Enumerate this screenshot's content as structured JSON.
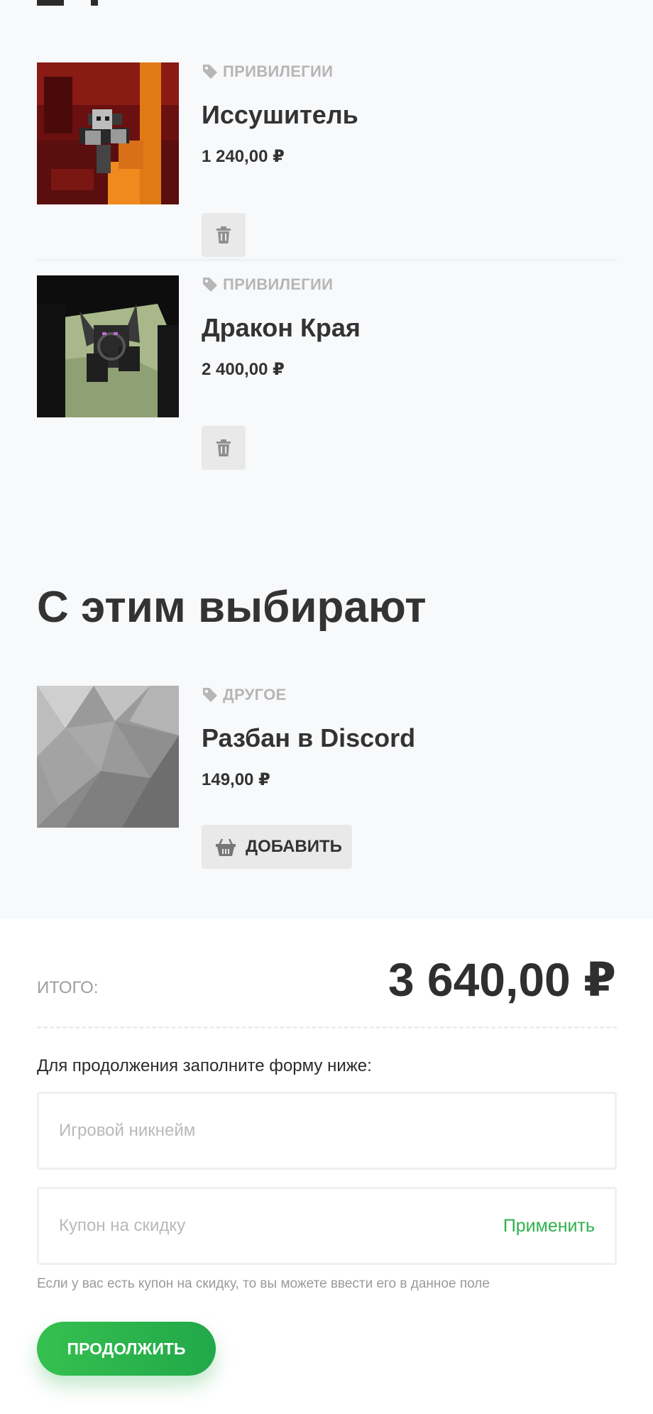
{
  "cart": {
    "items": [
      {
        "category": "ПРИВИЛЕГИИ",
        "name": "Иссушитель",
        "price": "1 240,00 ₽"
      },
      {
        "category": "ПРИВИЛЕГИИ",
        "name": "Дракон Края",
        "price": "2 400,00 ₽"
      }
    ]
  },
  "recommend": {
    "title": "С этим выбирают",
    "items": [
      {
        "category": "ДРУГОЕ",
        "name": "Разбан в Discord",
        "price": "149,00 ₽",
        "add_label": "ДОБАВИТЬ"
      }
    ]
  },
  "summary": {
    "total_label": "ИТОГО:",
    "total_value": "3 640,00 ₽"
  },
  "form": {
    "hint": "Для продолжения заполните форму ниже:",
    "nickname_placeholder": "Игровой никнейм",
    "coupon_placeholder": "Купон на скидку",
    "apply_label": "Применить",
    "coupon_note": "Если у вас есть купон на скидку, то вы можете ввести его в данное поле",
    "continue_label": "ПРОДОЛЖИТЬ"
  },
  "icons": {
    "tag": "tag-icon",
    "delete": "trash-icon",
    "add": "basket-icon"
  },
  "colors": {
    "accent": "#2fb24c",
    "button_gradient_start": "#35c04f",
    "button_gradient_end": "#22a84a",
    "muted": "#b6b6b6"
  }
}
